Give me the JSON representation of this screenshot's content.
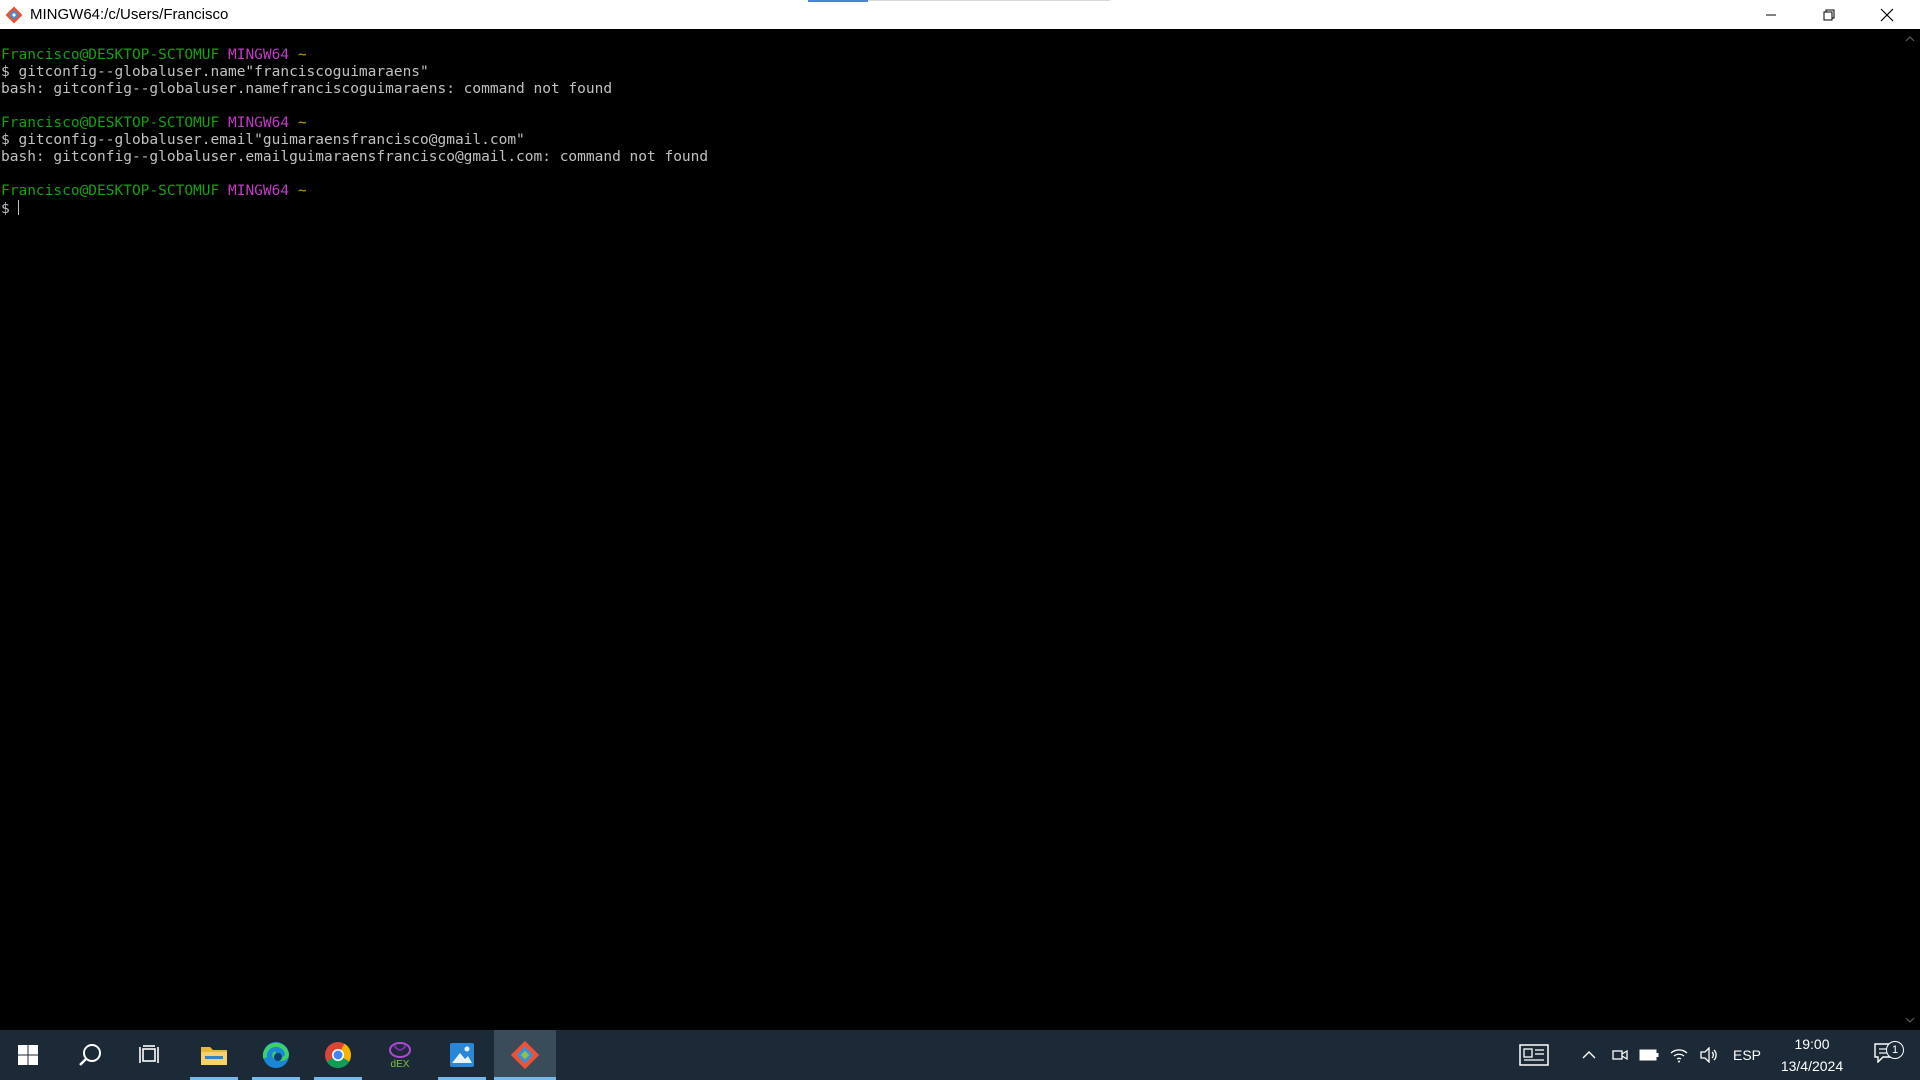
{
  "window": {
    "title": "MINGW64:/c/Users/Francisco"
  },
  "terminal": {
    "prompts": [
      {
        "user_host": "Francisco@DESKTOP-SCTOMUF",
        "env": "MINGW64",
        "dir": "~",
        "command": "$ gitconfig--globaluser.name\"franciscoguimaraens\"",
        "output": "bash: gitconfig--globaluser.namefranciscoguimaraens: command not found"
      },
      {
        "user_host": "Francisco@DESKTOP-SCTOMUF",
        "env": "MINGW64",
        "dir": "~",
        "command": "$ gitconfig--globaluser.email\"guimaraensfrancisco@gmail.com\"",
        "output": "bash: gitconfig--globaluser.emailguimaraensfrancisco@gmail.com: command not found"
      },
      {
        "user_host": "Francisco@DESKTOP-SCTOMUF",
        "env": "MINGW64",
        "dir": "~",
        "command": "$ "
      }
    ],
    "colors": {
      "user_host": "#13a10e",
      "env": "#c239c2",
      "dir": "#c0a000",
      "text": "#c0c0c0"
    }
  },
  "taskbar": {
    "apps": [
      {
        "name": "start",
        "icon": "windows-logo-icon"
      },
      {
        "name": "search",
        "icon": "search-icon"
      },
      {
        "name": "task-view",
        "icon": "task-view-icon"
      },
      {
        "name": "file-explorer",
        "icon": "folder-icon"
      },
      {
        "name": "edge",
        "icon": "edge-icon"
      },
      {
        "name": "chrome",
        "icon": "chrome-icon"
      },
      {
        "name": "dex",
        "icon": "dex-icon",
        "label": "dEX"
      },
      {
        "name": "photos",
        "icon": "photos-icon"
      },
      {
        "name": "git-bash",
        "icon": "git-icon"
      }
    ],
    "tray": {
      "language": "ESP",
      "time": "19:00",
      "date": "13/4/2024",
      "notification_count": "1"
    }
  }
}
